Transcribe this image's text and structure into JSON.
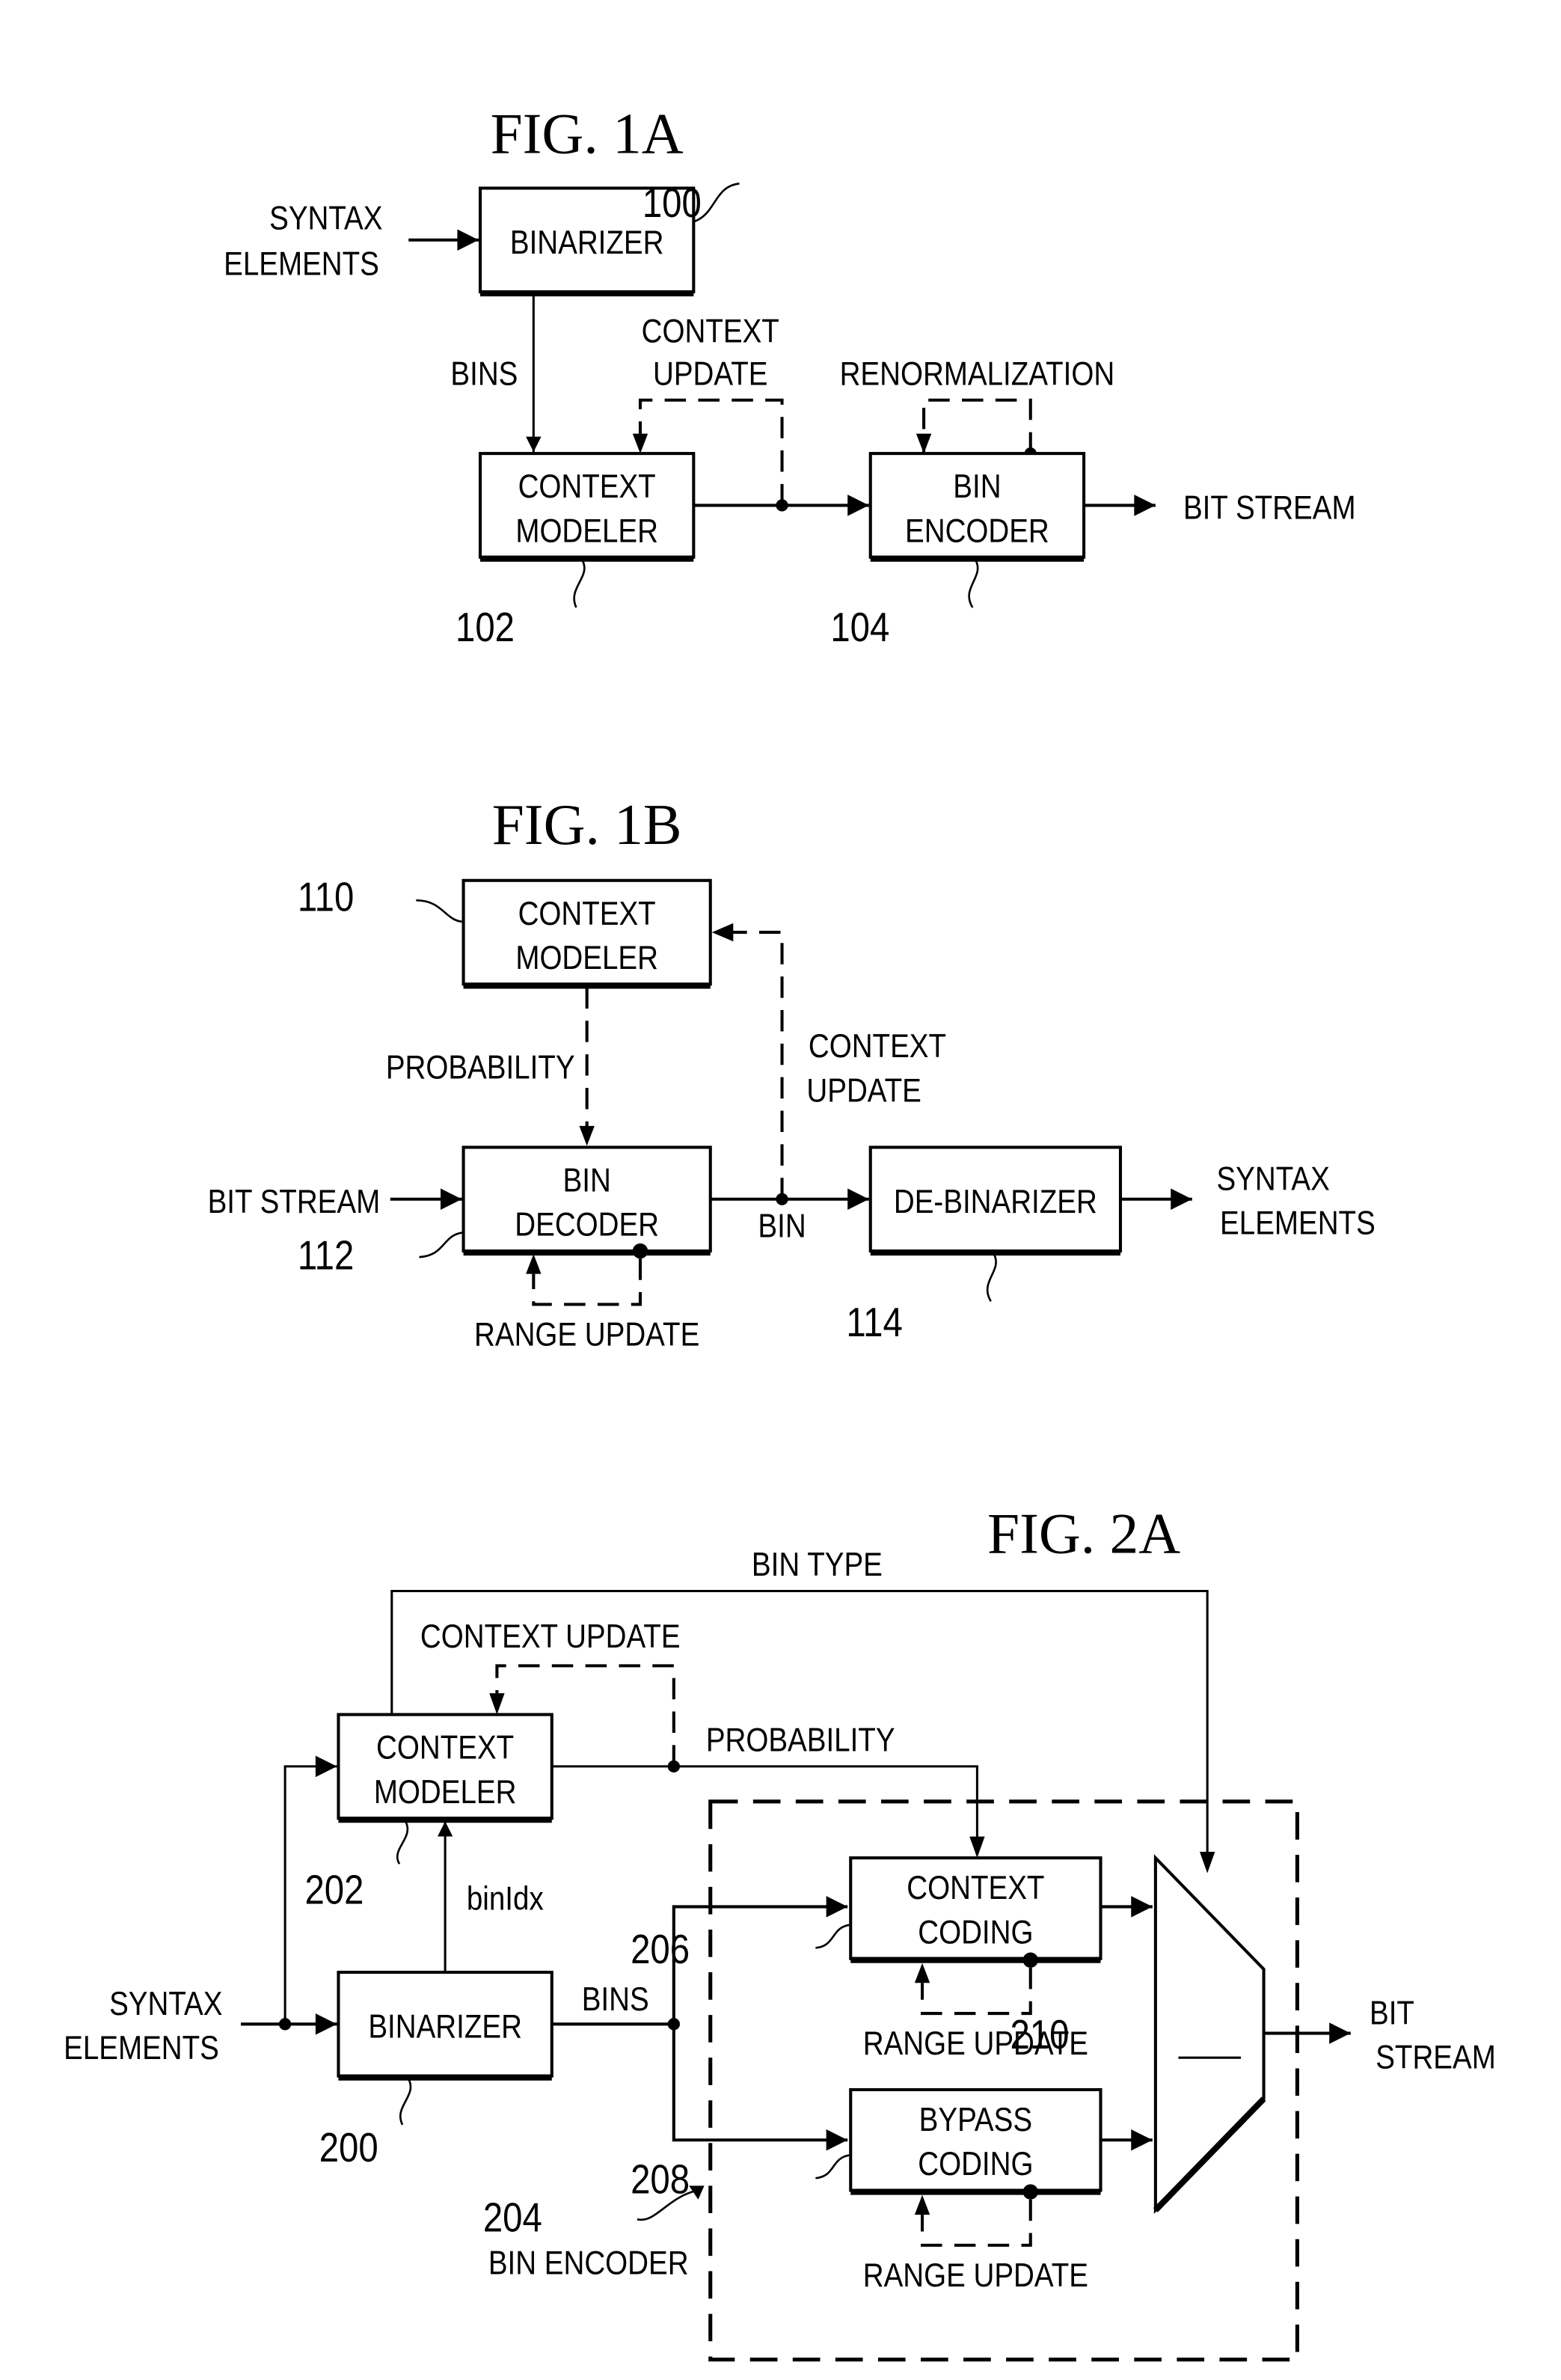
{
  "fig1a": {
    "title": "FIG. 1A",
    "input_label": [
      "SYNTAX",
      "ELEMENTS"
    ],
    "binarizer": {
      "label": "BINARIZER",
      "ref": "100"
    },
    "bins_label": "BINS",
    "context_update_label": [
      "CONTEXT",
      "UPDATE"
    ],
    "renorm_label": "RENORMALIZATION",
    "context_modeler": {
      "label": [
        "CONTEXT",
        "MODELER"
      ],
      "ref": "102"
    },
    "bin_encoder": {
      "label": [
        "BIN",
        "ENCODER"
      ],
      "ref": "104"
    },
    "output_label": "BIT STREAM"
  },
  "fig1b": {
    "title": "FIG. 1B",
    "context_modeler": {
      "label": [
        "CONTEXT",
        "MODELER"
      ],
      "ref": "110"
    },
    "probability_label": "PROBABILITY",
    "context_update_label": [
      "CONTEXT",
      "UPDATE"
    ],
    "input_label": "BIT STREAM",
    "bin_decoder": {
      "label": [
        "BIN",
        "DECODER"
      ],
      "ref": "112"
    },
    "bin_label": "BIN",
    "range_update_label": "RANGE UPDATE",
    "de_binarizer": {
      "label": "DE-BINARIZER",
      "ref": "114"
    },
    "output_label": [
      "SYNTAX",
      "ELEMENTS"
    ]
  },
  "fig2a": {
    "title": "FIG. 2A",
    "bin_type_label": "BIN TYPE",
    "context_update_label": "CONTEXT UPDATE",
    "probability_label": "PROBABILITY",
    "context_modeler": {
      "label": [
        "CONTEXT",
        "MODELER"
      ],
      "ref": "202"
    },
    "binidx_label": "binIdx",
    "input_label": [
      "SYNTAX",
      "ELEMENTS"
    ],
    "binarizer": {
      "label": "BINARIZER",
      "ref": "200"
    },
    "bins_label": "BINS",
    "context_coding": {
      "label": [
        "CONTEXT",
        "CODING"
      ],
      "ref": "206"
    },
    "bypass_coding": {
      "label": [
        "BYPASS",
        "CODING"
      ],
      "ref": "208"
    },
    "range_update_label_1": "RANGE UPDATE",
    "range_update_label_2": "RANGE UPDATE",
    "bin_encoder": {
      "ref": "204",
      "label": "BIN ENCODER"
    },
    "mux": {
      "ref": "210"
    },
    "output_label": [
      "BIT",
      "STREAM"
    ]
  }
}
